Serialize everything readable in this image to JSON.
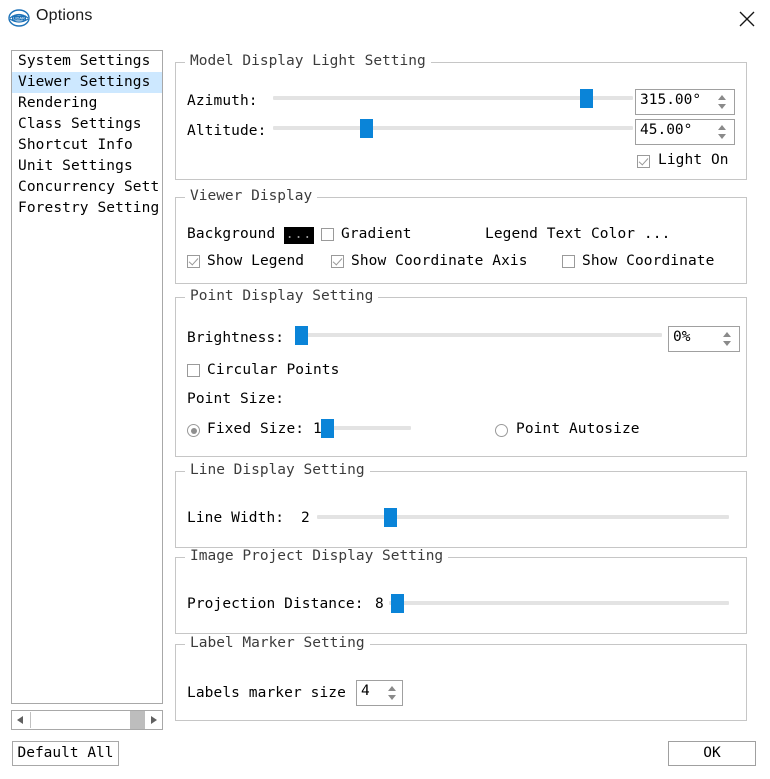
{
  "window": {
    "title": "Options",
    "logo_icon": "app-logo-icon",
    "close_icon": "close-icon"
  },
  "sidebar": {
    "items": [
      {
        "label": "System Settings",
        "selected": false
      },
      {
        "label": "Viewer Settings",
        "selected": true
      },
      {
        "label": "Rendering",
        "selected": false
      },
      {
        "label": "Class Settings",
        "selected": false
      },
      {
        "label": "Shortcut Info",
        "selected": false
      },
      {
        "label": "Unit Settings",
        "selected": false
      },
      {
        "label": "Concurrency Sett",
        "selected": false
      },
      {
        "label": "Forestry Setting",
        "selected": false
      }
    ],
    "scrollbar": {
      "left_arrow_icon": "scroll-left-icon",
      "right_arrow_icon": "scroll-right-icon"
    }
  },
  "buttons": {
    "default_all": "Default All",
    "ok": "OK"
  },
  "groups": {
    "light": {
      "title": "Model Display Light Setting",
      "azimuth_label": "Azimuth:",
      "azimuth_value": "315.00°",
      "azimuth_percent": 87,
      "altitude_label": "Altitude:",
      "altitude_value": "45.00°",
      "altitude_percent": 27,
      "light_on_label": "Light On",
      "light_on_checked": true
    },
    "viewer_display": {
      "title": "Viewer Display",
      "background_label": "Background",
      "background_color": "#000000",
      "background_swatch_text": "...",
      "gradient_label": "Gradient",
      "gradient_checked": false,
      "legend_text_color_label": "Legend Text Color ...",
      "show_legend_label": "Show Legend",
      "show_legend_checked": true,
      "show_coordinate_axis_label": "Show Coordinate Axis",
      "show_coordinate_axis_checked": true,
      "show_coordinate_label": "Show Coordinate",
      "show_coordinate_checked": false
    },
    "point_display": {
      "title": "Point Display Setting",
      "brightness_label": "Brightness:",
      "brightness_value": "0%",
      "brightness_percent": 0,
      "circular_points_label": "Circular Points",
      "circular_points_checked": false,
      "point_size_label": "Point Size:",
      "fixed_size_label": "Fixed Size:",
      "fixed_size_value": "1",
      "fixed_size_selected": true,
      "fixed_size_percent": 3,
      "point_autosize_label": "Point Autosize",
      "point_autosize_selected": false
    },
    "line_display": {
      "title": "Line Display Setting",
      "line_width_label": "Line Width:",
      "line_width_value": "2",
      "line_width_percent": 20
    },
    "image_project": {
      "title": "Image Project Display Setting",
      "projection_distance_label": "Projection Distance:",
      "projection_distance_value": "8",
      "projection_distance_percent": 1
    },
    "label_marker": {
      "title": "Label Marker Setting",
      "labels_marker_size_label": "Labels marker size",
      "labels_marker_size_value": "4"
    }
  },
  "colors": {
    "accent": "#0a84d8",
    "selection": "#cde8ff",
    "border": "#c6c6c6"
  }
}
